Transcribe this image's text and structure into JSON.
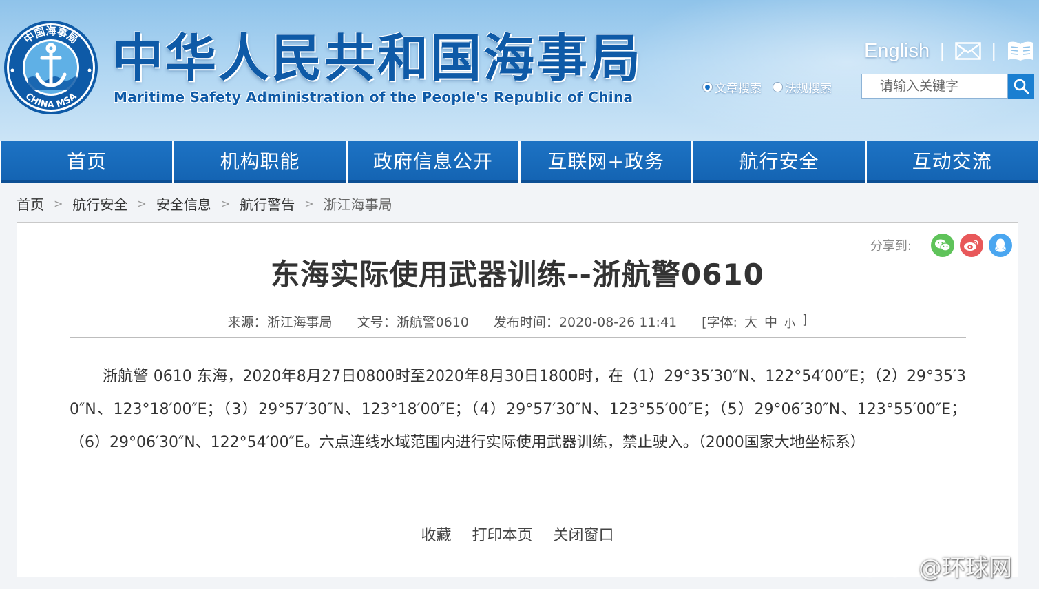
{
  "header": {
    "title_cn": "中华人民共和国海事局",
    "title_en": "Maritime Safety Administration of the People's Republic of China",
    "logo": {
      "top_text": "中国海事局",
      "bottom_text": "CHINA MSA",
      "icon": "anchor-icon"
    },
    "links": {
      "english": "English",
      "separator": "|",
      "mail_icon": "mail-icon",
      "book_icon": "book-icon"
    },
    "search": {
      "option_article": "文章搜索",
      "option_law": "法规搜索",
      "selected": "文章搜索",
      "placeholder": "请输入关键字",
      "button_icon": "search-icon"
    }
  },
  "nav": {
    "items": [
      "首页",
      "机构职能",
      "政府信息公开",
      "互联网+政务",
      "航行安全",
      "互动交流"
    ]
  },
  "breadcrumb": {
    "items": [
      "首页",
      "航行安全",
      "安全信息",
      "航行警告",
      "浙江海事局"
    ],
    "separator": ">"
  },
  "article": {
    "share_label": "分享到:",
    "share_icons": [
      "wechat-icon",
      "weibo-icon",
      "qq-icon"
    ],
    "title": "东海实际使用武器训练--浙航警0610",
    "meta": {
      "source": "来源：浙江海事局",
      "doc_no": "文号：浙航警0610",
      "publish_time": "发布时间：2020-08-26 11:41",
      "font_label": "[字体:",
      "font_large": "大",
      "font_medium": "中",
      "font_small": "小",
      "font_close": "]"
    },
    "body": "浙航警 0610  东海，2020年8月27日0800时至2020年8月30日1800时，在（1）29°35′30″N、122°54′00″E；（2）29°35′30″N、123°18′00″E；（3）29°57′30″N、123°18′00″E；（4）29°57′30″N、123°55′00″E；（5）29°06′30″N、123°55′00″E；（6）29°06′30″N、122°54′00″E。六点连线水域范围内进行实际使用武器训练，禁止驶入。（2000国家大地坐标系）",
    "actions": [
      "收藏",
      "打印本页",
      "关闭窗口"
    ]
  },
  "watermark": {
    "text": "@环球网"
  },
  "colors": {
    "brand_blue": "#0e5aa7",
    "nav_blue": "#1d73c4",
    "wechat_green": "#5fc35a",
    "weibo_red": "#e8585a",
    "qq_blue": "#4aa6f0"
  }
}
